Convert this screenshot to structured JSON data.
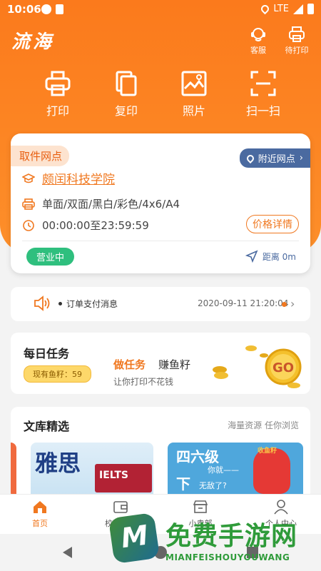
{
  "status_bar": {
    "time": "10:06",
    "network": "LTE"
  },
  "header": {
    "logo": "流海",
    "service_label": "客服",
    "pending_print_label": "待打印"
  },
  "quick_actions": [
    {
      "label": "打印",
      "icon": "printer-icon"
    },
    {
      "label": "复印",
      "icon": "copy-icon"
    },
    {
      "label": "照片",
      "icon": "photo-icon"
    },
    {
      "label": "扫一扫",
      "icon": "scan-icon"
    }
  ],
  "pickup": {
    "tag": "取件网点",
    "nearby_label": "附近网点",
    "site_name": "颇闰科技学院",
    "services": "单面/双面/黑白/彩色/4x6/A4",
    "hours": "00:00:00至23:59:59",
    "price_label": "价格详情",
    "status": "营业中",
    "distance": "距离 0m"
  },
  "notice": {
    "text": "订单支付消息",
    "time": "2020-09-11 21:20:04"
  },
  "task": {
    "title": "每日任务",
    "badge": "现有鱼籽：59",
    "do_task": "做任务",
    "earn": "赚鱼籽",
    "subtitle": "让你打印不花钱",
    "coin_text": "GO"
  },
  "library": {
    "title": "文库精选",
    "subtitle": "海量资源 任你浏览",
    "banner1_title": "雅思",
    "banner1_book": "IELTS",
    "banner2_line1": "四六级",
    "banner2_line2": "你就——",
    "banner2_line3": "下",
    "banner2_line4": "无敌了?",
    "banner2_badge": "收鱼籽"
  },
  "tabs": [
    {
      "label": "首页",
      "active": true
    },
    {
      "label": "校园文库",
      "active": false
    },
    {
      "label": "小卖部",
      "active": false
    },
    {
      "label": "个人中心",
      "active": false
    }
  ],
  "watermark": {
    "title": "免费手游网",
    "sub": "MIANFEISHOUYOUWANG",
    "badge": "M"
  },
  "colors": {
    "accent": "#f07820",
    "open": "#2fbf7e",
    "nearby": "#4a6aa0"
  }
}
